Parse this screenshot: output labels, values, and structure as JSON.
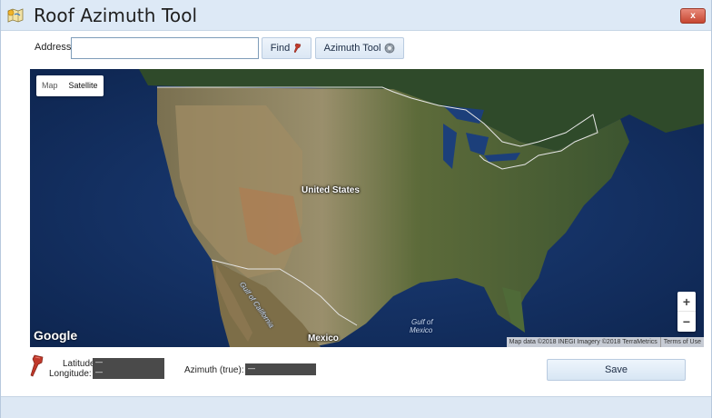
{
  "window": {
    "title": "Roof Azimuth Tool",
    "close_label": "x"
  },
  "address": {
    "label": "Address:",
    "value": "",
    "placeholder": ""
  },
  "toolbar": {
    "find_label": "Find",
    "azimuth_tool_label": "Azimuth Tool"
  },
  "map": {
    "type_options": [
      "Map",
      "Satellite"
    ],
    "selected_type": "Satellite",
    "labels": {
      "country": "United States",
      "mexico": "Mexico",
      "gulf_california": "Gulf of California",
      "gulf_mexico_1": "Gulf of",
      "gulf_mexico_2": "Mexico"
    },
    "logo": "Google",
    "attribution": "Map data ©2018 INEGI Imagery ©2018 TerraMetrics",
    "terms": "Terms of Use",
    "zoom_in": "+",
    "zoom_out": "−"
  },
  "location": {
    "latitude_label": "Latitude:",
    "longitude_label": "Longitude:",
    "latitude_value": "—",
    "longitude_value": "—",
    "azimuth_label": "Azimuth (true):",
    "azimuth_value": "—"
  },
  "actions": {
    "save_label": "Save"
  },
  "colors": {
    "titlebar": "#dde9f6",
    "close_button": "#c64631",
    "value_box": "#4a4a4a",
    "pin": "#c0392b"
  },
  "icons": {
    "app": "map-icon",
    "find": "pushpin-icon",
    "azimuth": "gear-icon",
    "location": "pushpin-icon"
  }
}
